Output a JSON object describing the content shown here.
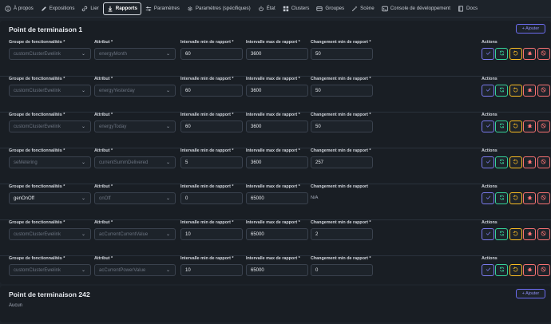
{
  "tabs": [
    {
      "label": "À propos",
      "icon": "info-icon"
    },
    {
      "label": "Expositions",
      "icon": "pencil-icon"
    },
    {
      "label": "Lier",
      "icon": "link-icon"
    },
    {
      "label": "Rapports",
      "icon": "download-icon",
      "active": true
    },
    {
      "label": "Paramètres",
      "icon": "sliders-icon"
    },
    {
      "label": "Paramètres (spécifiques)",
      "icon": "gear-icon"
    },
    {
      "label": "État",
      "icon": "power-icon"
    },
    {
      "label": "Clusters",
      "icon": "clusters-icon"
    },
    {
      "label": "Groupes",
      "icon": "group-icon"
    },
    {
      "label": "Scène",
      "icon": "wand-icon"
    },
    {
      "label": "Console de développement",
      "icon": "console-icon"
    },
    {
      "label": "Docs",
      "icon": "book-icon"
    }
  ],
  "labels": {
    "cluster": "Groupe de fonctionnalités *",
    "attribute": "Attribut *",
    "min_interval": "Intervalle min de rapport *",
    "max_interval": "Intervalle max de rapport *",
    "min_change": "Changement min de rapport *",
    "min_change_plain": "Changement min de rapport",
    "actions": "Actions"
  },
  "add_label": "+ Ajouter",
  "colors": {
    "accent": "#6c6cf0",
    "ok": "#7b7bef",
    "refresh": "#36d399",
    "undo": "#fbbd23",
    "delete": "#f87272"
  },
  "endpoints": [
    {
      "title": "Point de terminaison 1",
      "rows": [
        {
          "cluster": "customClusterEwelink",
          "attribute": "energyMonth",
          "min": "60",
          "max": "3600",
          "change": "50",
          "cluster_disabled": true
        },
        {
          "cluster": "customClusterEwelink",
          "attribute": "energyYesterday",
          "min": "60",
          "max": "3600",
          "change": "50",
          "cluster_disabled": true
        },
        {
          "cluster": "customClusterEwelink",
          "attribute": "energyToday",
          "min": "60",
          "max": "3600",
          "change": "50",
          "cluster_disabled": true
        },
        {
          "cluster": "seMetering",
          "attribute": "currentSummDelivered",
          "min": "5",
          "max": "3600",
          "change": "257",
          "cluster_disabled": true
        },
        {
          "cluster": "genOnOff",
          "attribute": "onOff",
          "min": "0",
          "max": "65000",
          "change_na": "N/A",
          "cluster_disabled": false
        },
        {
          "cluster": "customClusterEwelink",
          "attribute": "acCurrentCurrentValue",
          "min": "10",
          "max": "65000",
          "change": "2",
          "cluster_disabled": true
        },
        {
          "cluster": "customClusterEwelink",
          "attribute": "acCurrentPowerValue",
          "min": "10",
          "max": "65000",
          "change": "0",
          "cluster_disabled": true
        }
      ]
    },
    {
      "title": "Point de terminaison 242",
      "empty_text": "Aucun"
    }
  ]
}
